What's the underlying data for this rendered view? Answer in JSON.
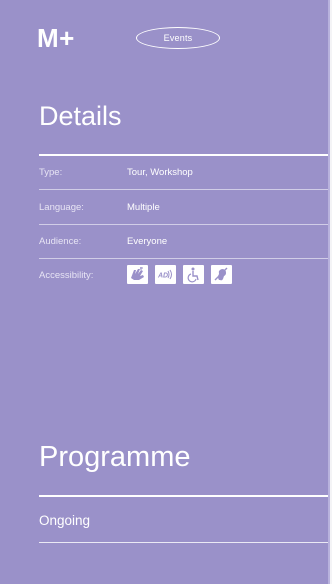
{
  "header": {
    "logo": "M+",
    "pill_label": "Events"
  },
  "details": {
    "title": "Details",
    "rows": [
      {
        "label": "Type:",
        "value": "Tour, Workshop"
      },
      {
        "label": "Language:",
        "value": "Multiple"
      },
      {
        "label": "Audience:",
        "value": "Everyone"
      },
      {
        "label": "Accessibility:"
      }
    ],
    "accessibility_icons": [
      "sign-language-icon",
      "audio-description-icon",
      "wheelchair-icon",
      "assistive-listening-icon"
    ],
    "accessibility_icon_text": {
      "audio_description": "AD"
    }
  },
  "programme": {
    "title": "Programme",
    "status": "Ongoing"
  },
  "colors": {
    "panel_background": "#9a91c9",
    "text": "#ffffff"
  }
}
